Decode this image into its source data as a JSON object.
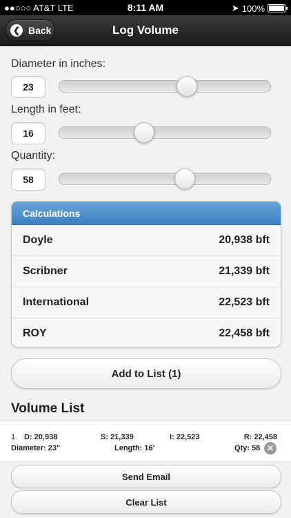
{
  "status_bar": {
    "carrier": "●●○○○ AT&T  LTE",
    "time": "8:11 AM",
    "battery": "100%",
    "battery_level": 1.0
  },
  "nav": {
    "title": "Log Volume",
    "back_label": "Back"
  },
  "inputs": {
    "diameter": {
      "label": "Diameter in inches:",
      "value": "23",
      "slider_fraction": 0.6
    },
    "length": {
      "label": "Length in feet:",
      "value": "16",
      "slider_fraction": 0.4
    },
    "quantity": {
      "label": "Quantity:",
      "value": "58",
      "slider_fraction": 0.59
    }
  },
  "calculations": {
    "header": "Calculations",
    "rows": [
      {
        "name": "Doyle",
        "value": "20,938 bft"
      },
      {
        "name": "Scribner",
        "value": "21,339 bft"
      },
      {
        "name": "International",
        "value": "22,523 bft"
      },
      {
        "name": "ROY",
        "value": "22,458 bft"
      }
    ]
  },
  "add_button": "Add to List (1)",
  "volume_list": {
    "title": "Volume List",
    "items": [
      {
        "index": "1.",
        "d": "D: 20,938",
        "s": "S: 21,339",
        "i": "I: 22,523",
        "r": "R: 22,458",
        "diameter": "Diameter: 23\"",
        "length": "Length: 16'",
        "qty": "Qty: 58"
      }
    ]
  },
  "send_email": "Send Email",
  "clear_list": "Clear List",
  "colors": {
    "accent": "#3b7fc0",
    "nav_bar": "#262626"
  }
}
